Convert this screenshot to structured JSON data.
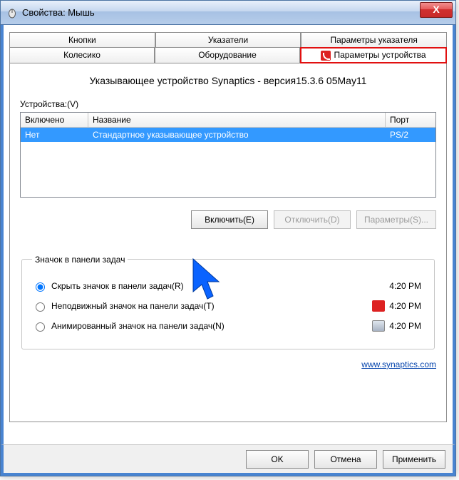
{
  "window": {
    "title": "Свойства: Мышь",
    "close": "X"
  },
  "tabs": {
    "row1": [
      "Кнопки",
      "Указатели",
      "Параметры указателя"
    ],
    "row2": [
      "Колесико",
      "Оборудование",
      "Параметры устройства"
    ],
    "active": "Параметры устройства"
  },
  "heading": "Указывающее устройство Synaptics - версия15.3.6 05May11",
  "devicesLabel": "Устройства:(V)",
  "table": {
    "headers": {
      "enabled": "Включено",
      "name": "Название",
      "port": "Порт"
    },
    "rows": [
      {
        "enabled": "Нет",
        "name": "Стандартное указывающее устройство",
        "port": "PS/2"
      }
    ]
  },
  "buttons": {
    "enable": "Включить(E)",
    "disable": "Отключить(D)",
    "params": "Параметры(S)..."
  },
  "tray": {
    "legend": "Значок в панели задач",
    "opt1": "Скрыть значок в панели задач(R)",
    "opt2": "Неподвижный значок на панели задач(T)",
    "opt3": "Анимированный значок на панели задач(N)",
    "time1": "4:20 PM",
    "time2": "4:20 PM",
    "time3": "4:20 PM"
  },
  "link": {
    "text": "www.synaptics.com"
  },
  "footer": {
    "ok": "OK",
    "cancel": "Отмена",
    "apply": "Применить"
  }
}
